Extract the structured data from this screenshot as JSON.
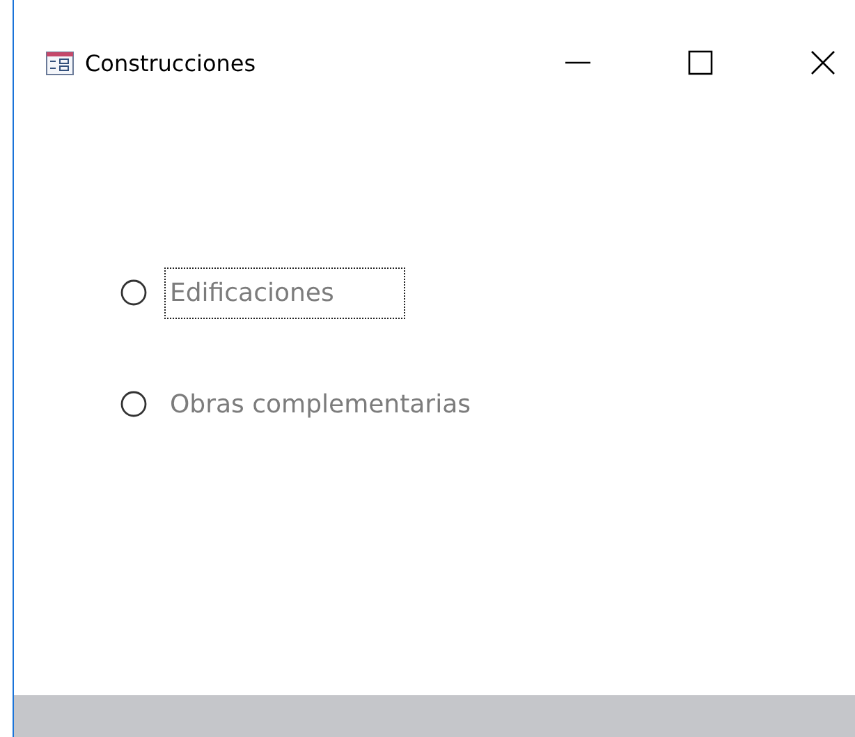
{
  "window": {
    "title": "Construcciones"
  },
  "options": [
    {
      "label": "Edificaciones",
      "selected": false,
      "focused": true
    },
    {
      "label": "Obras complementarias",
      "selected": false,
      "focused": false
    }
  ]
}
